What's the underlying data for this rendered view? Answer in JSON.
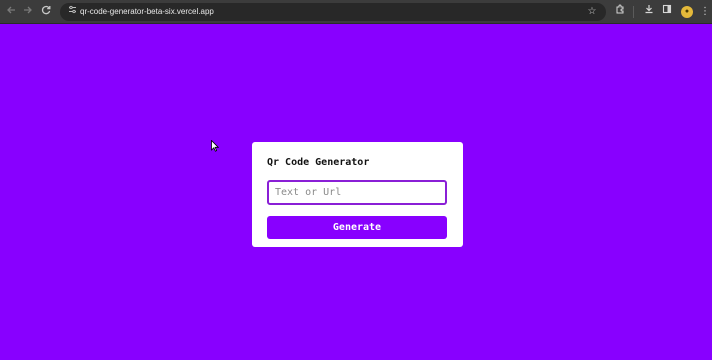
{
  "browser": {
    "url": "qr-code-generator-beta-six.vercel.app",
    "icons": {
      "back": "back-arrow-icon",
      "forward": "forward-arrow-icon",
      "reload": "reload-icon",
      "site_info": "site-info-icon",
      "bookmark": "star-icon",
      "extensions": "puzzle-icon",
      "downloads": "download-icon",
      "side_panel": "side-panel-icon",
      "menu": "kebab-menu-icon"
    }
  },
  "app": {
    "title": "Qr Code Generator",
    "input_placeholder": "Text or Url",
    "input_value": "",
    "button_label": "Generate"
  },
  "colors": {
    "background": "#8800ff",
    "card": "#ffffff",
    "input_border": "#8a1fd6",
    "button": "#8800ff",
    "button_text": "#ffffff"
  }
}
